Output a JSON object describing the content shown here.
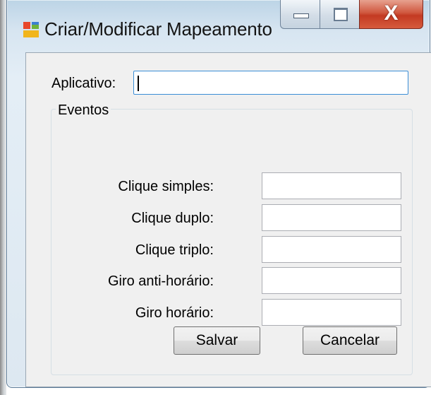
{
  "window": {
    "title": "Criar/Modificar Mapeamento",
    "controls": {
      "minimize": "minimize",
      "maximize": "maximize",
      "close": "X"
    }
  },
  "form": {
    "app_label": "Aplicativo:",
    "app_value": "",
    "group_title": "Eventos",
    "events": [
      {
        "label": "Clique simples:",
        "value": ""
      },
      {
        "label": "Clique duplo:",
        "value": ""
      },
      {
        "label": "Clique triplo:",
        "value": ""
      },
      {
        "label": "Giro anti-horário:",
        "value": ""
      },
      {
        "label": "Giro horário:",
        "value": ""
      }
    ],
    "save_label": "Salvar",
    "cancel_label": "Cancelar"
  },
  "colors": {
    "close_button": "#c9442b",
    "focus_border": "#3b8ed6",
    "client_bg": "#f0f0f0"
  }
}
